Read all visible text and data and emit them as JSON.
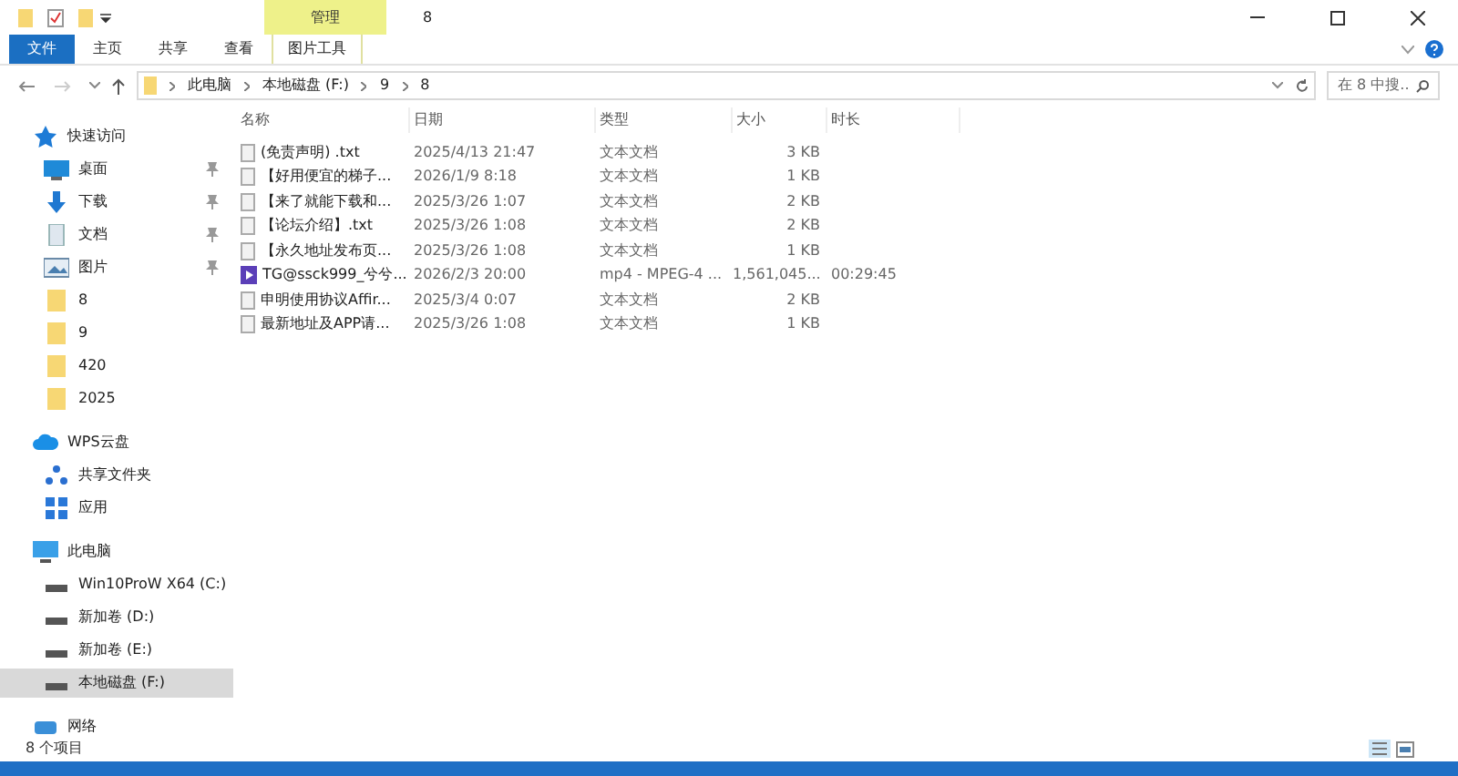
{
  "window": {
    "title": "8",
    "context_tab": "管理"
  },
  "ribbon_tabs": [
    {
      "label": "文件",
      "kind": "file"
    },
    {
      "label": "主页",
      "kind": "tab"
    },
    {
      "label": "共享",
      "kind": "tab"
    },
    {
      "label": "查看",
      "kind": "tab"
    },
    {
      "label": "图片工具",
      "kind": "context"
    }
  ],
  "address": {
    "path": [
      "此电脑",
      "本地磁盘 (F:)",
      "9",
      "8"
    ],
    "search_placeholder": "在 8 中搜..."
  },
  "sidebar": [
    {
      "label": "快速访问",
      "selected": false,
      "children": [
        {
          "label": "桌面",
          "pinned": true,
          "selected": false
        },
        {
          "label": "下载",
          "pinned": true,
          "selected": false
        },
        {
          "label": "文档",
          "pinned": true,
          "selected": false
        },
        {
          "label": "图片",
          "pinned": true,
          "selected": false
        },
        {
          "label": "8",
          "pinned": false,
          "selected": false
        },
        {
          "label": "9",
          "pinned": false,
          "selected": false
        },
        {
          "label": "420",
          "pinned": false,
          "selected": false
        },
        {
          "label": "2025",
          "pinned": false,
          "selected": false
        }
      ]
    },
    {
      "label": "WPS云盘",
      "selected": false,
      "children": [
        {
          "label": "共享文件夹",
          "pinned": false,
          "selected": false
        },
        {
          "label": "应用",
          "pinned": false,
          "selected": false
        }
      ]
    },
    {
      "label": "此电脑",
      "selected": false,
      "children": [
        {
          "label": "Win10ProW X64 (C:)",
          "pinned": false,
          "selected": false
        },
        {
          "label": "新加卷 (D:)",
          "pinned": false,
          "selected": false
        },
        {
          "label": "新加卷 (E:)",
          "pinned": false,
          "selected": false
        },
        {
          "label": "本地磁盘 (F:)",
          "pinned": false,
          "selected": true
        }
      ]
    },
    {
      "label": "网络",
      "selected": false
    }
  ],
  "table": {
    "columns": [
      "名称",
      "日期",
      "类型",
      "大小",
      "时长"
    ],
    "rows": [
      {
        "kind": "text",
        "name": "(免责声明) .txt",
        "date": "2025/4/13 21:47",
        "type": "文本文档",
        "size": "3 KB"
      },
      {
        "kind": "text",
        "name": "【好用便宜的梯子...",
        "date": "2026/1/9 8:18",
        "type": "文本文档",
        "size": "1 KB"
      },
      {
        "kind": "text",
        "name": "【来了就能下载和...",
        "date": "2025/3/26 1:07",
        "type": "文本文档",
        "size": "2 KB"
      },
      {
        "kind": "text",
        "name": "【论坛介绍】.txt",
        "date": "2025/3/26 1:08",
        "type": "文本文档",
        "size": "2 KB"
      },
      {
        "kind": "text",
        "name": "【永久地址发布页...",
        "date": "2025/3/26 1:08",
        "type": "文本文档",
        "size": "1 KB"
      },
      {
        "kind": "video",
        "name": "TG@ssck999_兮兮...",
        "date": "2026/2/3 20:00",
        "type": "mp4 - MPEG-4 ...",
        "size": "1,561,045...",
        "length": "00:29:45"
      },
      {
        "kind": "text",
        "name": "申明使用协议Affir...",
        "date": "2025/3/4 0:07",
        "type": "文本文档",
        "size": "2 KB"
      },
      {
        "kind": "text",
        "name": "最新地址及APP请...",
        "date": "2025/3/26 1:08",
        "type": "文本文档",
        "size": "1 KB"
      }
    ]
  },
  "status_bar": {
    "count": "8 个项目"
  }
}
